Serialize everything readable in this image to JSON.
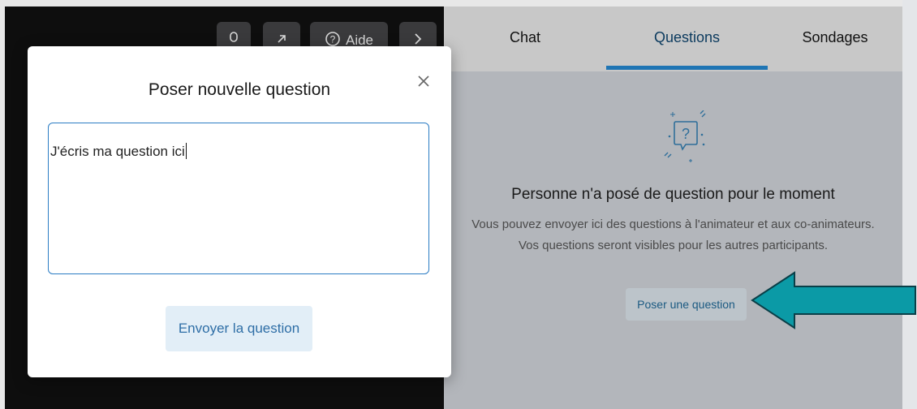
{
  "stage": {
    "toolbar": {
      "mic_icon": "microphone-icon",
      "popout_icon": "popout-arrow-icon",
      "help_icon": "help-circle-icon",
      "help_label": "Aide",
      "next_icon": "chevron-right-icon"
    }
  },
  "panel": {
    "tabs": [
      {
        "label": "Chat",
        "active": false
      },
      {
        "label": "Questions",
        "active": true
      },
      {
        "label": "Sondages",
        "active": false
      }
    ],
    "empty_state": {
      "icon": "question-bubble-icon",
      "title": "Personne n'a posé de question pour le moment",
      "description": "Vous pouvez envoyer ici des questions à l'animateur et aux co-animateurs. Vos questions seront visibles pour les autres participants.",
      "button_label": "Poser une question"
    },
    "annotation": {
      "type": "arrow",
      "color": "#0b9aa6",
      "points_to": "Poser une question"
    }
  },
  "modal": {
    "title": "Poser nouvelle question",
    "close_icon": "close-icon",
    "input_value": "J'écris ma question ici",
    "send_label": "Envoyer la question"
  },
  "colors": {
    "accent": "#1f75b4",
    "stage_background": "#0e0e0e",
    "panel_background": "#b3b6bb",
    "arrow": "#0b9aa6"
  }
}
